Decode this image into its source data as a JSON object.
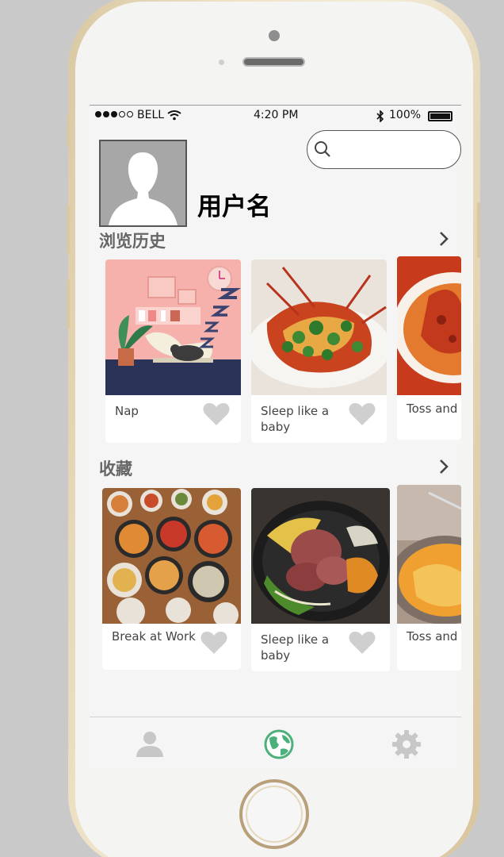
{
  "status_bar": {
    "carrier": "BELL",
    "time": "4:20 PM",
    "battery": "100%",
    "signal_bars_filled": 3,
    "signal_bars_total": 5
  },
  "profile": {
    "username": "用户名"
  },
  "search": {
    "placeholder": "",
    "value": ""
  },
  "history": {
    "title": "浏览历史",
    "cards": [
      {
        "title": "Nap",
        "image": "cartoon-nap-illustration"
      },
      {
        "title": "Sleep like a baby",
        "image": "lobster-dish-photo"
      },
      {
        "title": "Toss and",
        "image": "crab-dish-photo"
      }
    ]
  },
  "favorites": {
    "title": "收藏",
    "cards": [
      {
        "title": "Break at Work",
        "image": "korean-meal-spread-photo"
      },
      {
        "title": "Sleep like a baby",
        "image": "bbq-grill-photo"
      },
      {
        "title": "Toss and",
        "image": "noodle-hotpot-photo"
      }
    ]
  },
  "tabbar": {
    "items": [
      {
        "icon": "person-icon",
        "active": false
      },
      {
        "icon": "globe-icon",
        "active": true
      },
      {
        "icon": "gear-icon",
        "active": false
      }
    ],
    "active_color": "#4bb07a",
    "inactive_color": "#c7c7c7"
  },
  "colors": {
    "heart": "#cfcfcf",
    "section_title": "#666666"
  }
}
